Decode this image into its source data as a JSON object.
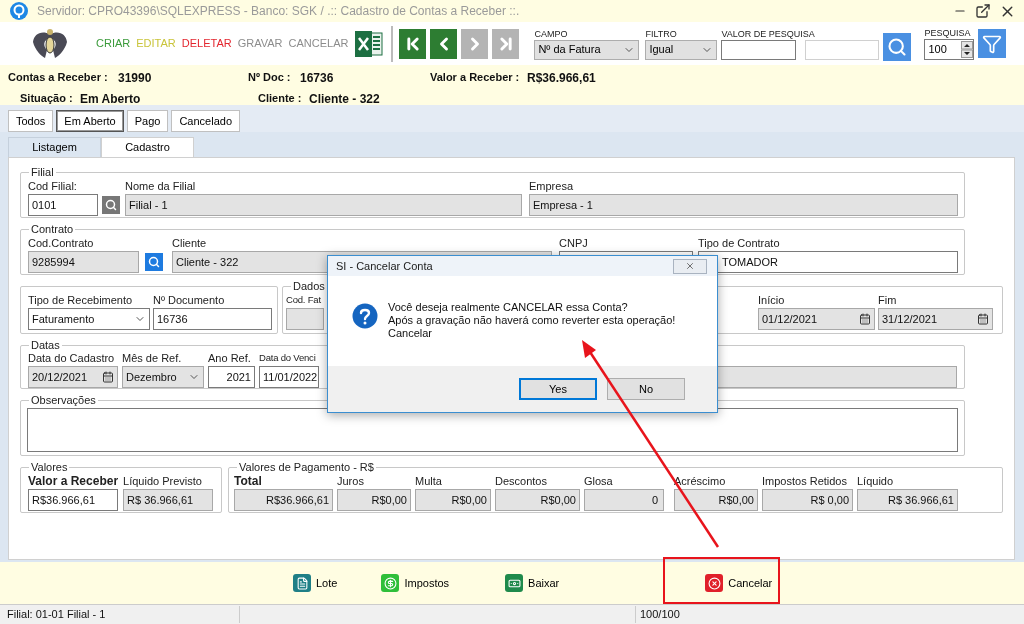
{
  "window": {
    "title": "Servidor: CPRO43396\\SQLEXPRESS - Banco: SGK / .:: Cadastro de Contas a Receber ::."
  },
  "toolbar": {
    "actions": [
      {
        "label": "CRIAR",
        "color": "#3a9a3a"
      },
      {
        "label": "EDITAR",
        "color": "#c9c43a"
      },
      {
        "label": "DELETAR",
        "color": "#e3262f"
      },
      {
        "label": "GRAVAR",
        "color": "#8c8c8c"
      },
      {
        "label": "CANCELAR",
        "color": "#8c8c8c"
      }
    ],
    "nav": [
      {
        "kind": "first",
        "disabled": false
      },
      {
        "kind": "prev",
        "disabled": false
      },
      {
        "kind": "next",
        "disabled": true
      },
      {
        "kind": "last",
        "disabled": true
      }
    ]
  },
  "search": {
    "campo": {
      "label": "CAMPO",
      "value": "Nº da Fatura"
    },
    "filtro": {
      "label": "FILTRO",
      "value": "Igual"
    },
    "valor_label": "VALOR DE PESQUISA",
    "pesquisa": {
      "label": "PESQUISA",
      "value": "100"
    }
  },
  "summary": {
    "contas": {
      "label": "Contas a Receber :",
      "value": "31990"
    },
    "doc": {
      "label": "Nº Doc :",
      "value": "16736"
    },
    "valor": {
      "label": "Valor a Receber :",
      "value": "R$36.966,61"
    },
    "situacao": {
      "label": "Situação :",
      "value": "Em Aberto"
    },
    "cliente": {
      "label": "Cliente :",
      "value": "Cliente - 322"
    }
  },
  "status_tabs": [
    {
      "label": "Todos",
      "selected": false
    },
    {
      "label": "Em Aberto",
      "selected": true
    },
    {
      "label": "Pago",
      "selected": false
    },
    {
      "label": "Cancelado",
      "selected": false
    }
  ],
  "view_tabs": [
    {
      "label": "Listagem",
      "selected": false
    },
    {
      "label": "Cadastro",
      "selected": true
    }
  ],
  "filial": {
    "title": "Filial",
    "cod": {
      "label": "Cod Filial:",
      "value": "0101",
      "disabled": false
    },
    "nome": {
      "label": "Nome da Filial",
      "value": "Filial - 1",
      "disabled": true
    },
    "empresa": {
      "label": "Empresa",
      "value": "Empresa - 1",
      "disabled": true
    }
  },
  "contrato": {
    "title": "Contrato",
    "cod": {
      "label": "Cod.Contrato",
      "value": "9285994",
      "disabled": true
    },
    "cliente": {
      "label": "Cliente",
      "value": "Cliente - 322",
      "disabled": true
    },
    "cnpj": {
      "label": "CNPJ",
      "disabled": false
    },
    "tipo": {
      "label": "Tipo de Contrato",
      "value": "TOMADOR",
      "disabled": false
    }
  },
  "recebimento": {
    "tipo": {
      "label": "Tipo de Recebimento",
      "value": "Faturamento",
      "disabled": false
    },
    "documento": {
      "label": "Nº Documento",
      "value": "16736",
      "disabled": false
    }
  },
  "dados": {
    "title": "Dados",
    "cod_label": "Cod. Fat",
    "inicio": {
      "label": "Início",
      "value": "01/12/2021",
      "disabled": true
    },
    "fim": {
      "label": "Fim",
      "value": "31/12/2021",
      "disabled": true
    }
  },
  "datas": {
    "title": "Datas",
    "cadastro": {
      "label": "Data do Cadastro",
      "value": "20/12/2021",
      "disabled": true
    },
    "mes": {
      "label": "Mês de Ref.",
      "value": "Dezembro",
      "disabled": true
    },
    "ano": {
      "label": "Ano Ref.",
      "value": "2021",
      "disabled": false
    },
    "vencimento": {
      "label": "Data do Venci",
      "value": "11/01/2022",
      "disabled": false
    }
  },
  "observacoes": {
    "title": "Observações"
  },
  "valores": {
    "title": "Valores",
    "valor": {
      "label": "Valor a Receber",
      "value": "R$36.966,61",
      "disabled": false
    },
    "liquido": {
      "label": "Líquido Previsto",
      "value": "R$ 36.966,61",
      "disabled": true
    }
  },
  "pagamento": {
    "title": "Valores de Pagamento - R$",
    "fields": [
      {
        "label": "Total",
        "value": "R$36.966,61",
        "disabled": true
      },
      {
        "label": "Juros",
        "value": "R$0,00",
        "disabled": true
      },
      {
        "label": "Multa",
        "value": "R$0,00",
        "disabled": true
      },
      {
        "label": "Descontos",
        "value": "R$0,00",
        "disabled": true
      },
      {
        "label": "Glosa",
        "value": "0",
        "disabled": true
      },
      {
        "label": "Acréscimo",
        "value": "R$0,00",
        "disabled": true
      },
      {
        "label": "Impostos Retidos",
        "value": "R$ 0,00",
        "disabled": true
      },
      {
        "label": "Líquido",
        "value": "R$ 36.966,61",
        "disabled": true
      }
    ]
  },
  "dialog": {
    "title": "SI - Cancelar Conta",
    "lines": [
      "Você deseja realmente CANCELAR essa Conta?",
      "Após a gravação não haverá como reverter esta operação!",
      "Cancelar"
    ],
    "buttons": [
      {
        "label": "Yes",
        "selected": true
      },
      {
        "label": "No",
        "selected": false
      }
    ]
  },
  "bottom_actions": [
    {
      "kind": "lote",
      "label": "Lote"
    },
    {
      "kind": "impostos",
      "label": "Impostos"
    },
    {
      "kind": "baixar",
      "label": "Baixar"
    },
    {
      "kind": "cancelar",
      "label": "Cancelar"
    }
  ],
  "status_bar": [
    "Filial: 01-01 Filial - 1",
    "100/100"
  ]
}
